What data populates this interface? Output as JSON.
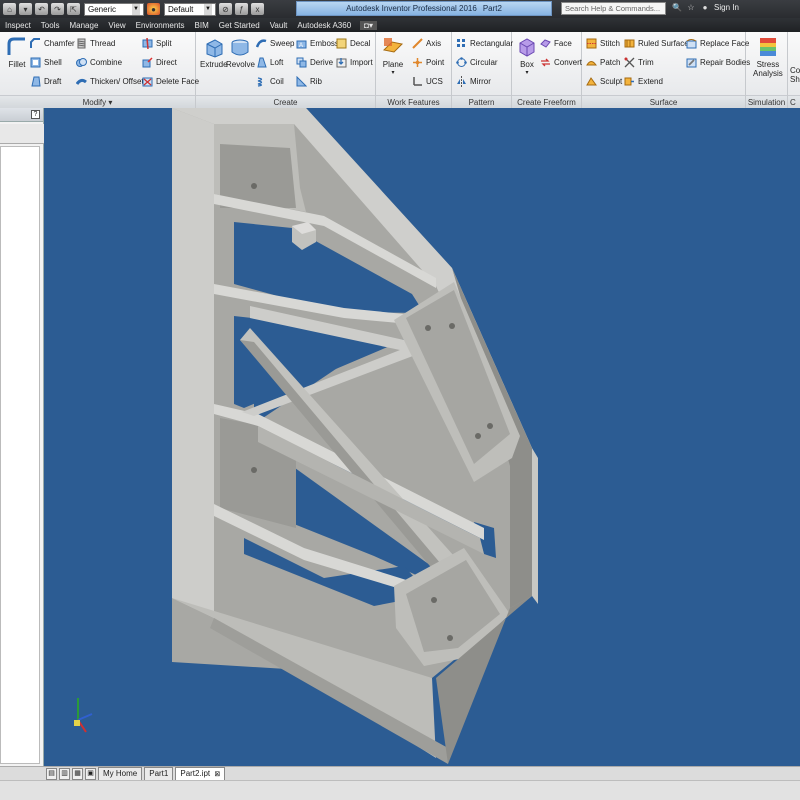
{
  "qat": {
    "material": "Generic",
    "appearance": "Default",
    "title_app": "Autodesk Inventor Professional 2016",
    "title_doc": "Part2",
    "search_placeholder": "Search Help & Commands...",
    "sign_in": "Sign In"
  },
  "ribbon_tabs": [
    "Inspect",
    "Tools",
    "Manage",
    "View",
    "Environments",
    "BIM",
    "Get Started",
    "Vault",
    "Autodesk A360"
  ],
  "ribbon": {
    "modify": {
      "label": "Modify",
      "fillet": "Fillet",
      "chamfer": "Chamfer",
      "shell": "Shell",
      "draft": "Draft",
      "thread": "Thread",
      "combine": "Combine",
      "thicken": "Thicken/ Offset",
      "split": "Split",
      "direct": "Direct",
      "delete_face": "Delete Face"
    },
    "create": {
      "label": "Create",
      "extrude": "Extrude",
      "revolve": "Revolve",
      "sweep": "Sweep",
      "loft": "Loft",
      "coil": "Coil",
      "emboss": "Emboss",
      "derive": "Derive",
      "rib": "Rib",
      "decal": "Decal",
      "import": "Import"
    },
    "work_features": {
      "label": "Work Features",
      "plane": "Plane",
      "axis": "Axis",
      "point": "Point",
      "ucs": "UCS"
    },
    "pattern": {
      "label": "Pattern",
      "rectangular": "Rectangular",
      "circular": "Circular",
      "mirror": "Mirror"
    },
    "freeform": {
      "label": "Create Freeform",
      "box": "Box",
      "face": "Face",
      "convert": "Convert"
    },
    "surface": {
      "label": "Surface",
      "stitch": "Stitch",
      "patch": "Patch",
      "sculpt": "Sculpt",
      "ruled_surface": "Ruled Surface",
      "trim": "Trim",
      "extend": "Extend",
      "replace_face": "Replace Face",
      "repair_bodies": "Repair Bodies"
    },
    "simulation": {
      "label": "Simulation",
      "stress": "Stress",
      "analysis": "Analysis"
    },
    "cut": {
      "a": "Co",
      "b": "Sh",
      "label": "C"
    }
  },
  "doc_tabs": [
    "My Home",
    "Part1",
    "Part2.ipt"
  ],
  "colors": {
    "viewport": "#2c5c93",
    "part_light": "#d3d3d0",
    "part_mid": "#bdbdb9",
    "part_dark": "#9c9c98"
  }
}
